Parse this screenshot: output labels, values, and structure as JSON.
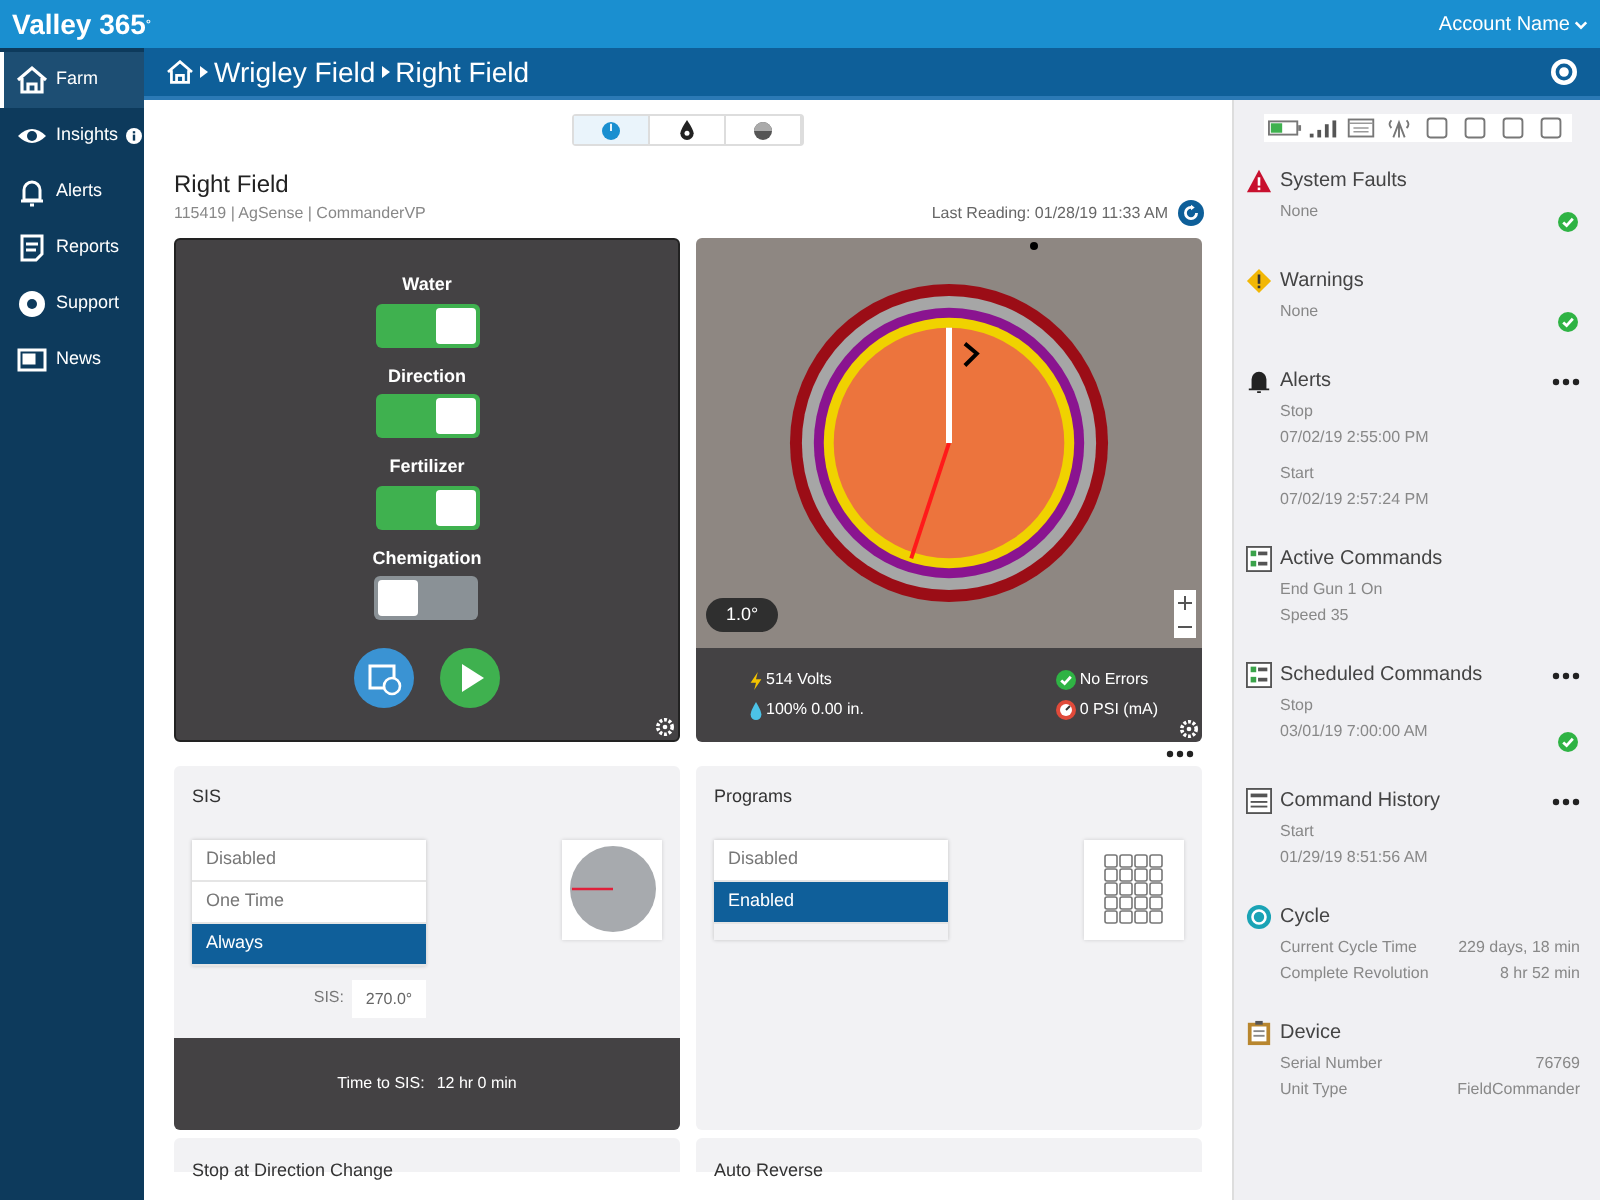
{
  "header": {
    "brand": "Valley 365",
    "brand_mark": "°",
    "account": "Account Name"
  },
  "sidebar": {
    "items": [
      {
        "label": "Farm",
        "kind": "farm",
        "selected": true,
        "badge": false
      },
      {
        "label": "Insights",
        "kind": "insights",
        "selected": false,
        "badge": true
      },
      {
        "label": "Alerts",
        "kind": "alerts",
        "selected": false,
        "badge": false
      },
      {
        "label": "Reports",
        "kind": "reports",
        "selected": false,
        "badge": false
      },
      {
        "label": "Support",
        "kind": "support",
        "selected": false,
        "badge": false
      },
      {
        "label": "News",
        "kind": "news",
        "selected": false,
        "badge": false
      }
    ]
  },
  "breadcrumb": [
    "Wrigley Field",
    "Right Field"
  ],
  "view_tabs": [
    {
      "kind": "pivot",
      "selected": true
    },
    {
      "kind": "drop",
      "selected": false
    },
    {
      "kind": "globe",
      "selected": false
    }
  ],
  "field": {
    "title": "Right Field",
    "subtitle": "115419 | AgSense | CommanderVP",
    "last_reading": "Last Reading: 01/28/19 11:33 AM"
  },
  "toggles": [
    {
      "label": "Water",
      "on": true
    },
    {
      "label": "Direction",
      "on": true
    },
    {
      "label": "Fertilizer",
      "on": true
    },
    {
      "label": "Chemigation",
      "on": false
    }
  ],
  "map": {
    "angle": "1.0°",
    "stats": [
      {
        "kind": "volts",
        "text": "514 Volts"
      },
      {
        "kind": "ok",
        "text": "No Errors"
      },
      {
        "kind": "water",
        "text": "100% 0.00 in."
      },
      {
        "kind": "pressure",
        "text": "0 PSI (mA)"
      }
    ]
  },
  "sis": {
    "title": "SIS",
    "options": [
      {
        "label": "Disabled",
        "selected": false
      },
      {
        "label": "One Time",
        "selected": false
      },
      {
        "label": "Always",
        "selected": true
      }
    ],
    "field_label": "SIS:",
    "field_value": "270.0°",
    "time_label": "Time to SIS:",
    "time_value": "12 hr 0 min"
  },
  "programs": {
    "title": "Programs",
    "options": [
      {
        "label": "Disabled",
        "selected": false
      },
      {
        "label": "Enabled",
        "selected": true
      }
    ]
  },
  "lower_panels": [
    "Stop at Direction Change",
    "Auto Reverse"
  ],
  "status_sections": [
    {
      "kind": "fault",
      "title": "System Faults",
      "groups": [
        [
          "None"
        ]
      ],
      "ok": true,
      "menu": false
    },
    {
      "kind": "warning",
      "title": "Warnings",
      "groups": [
        [
          "None"
        ]
      ],
      "ok": true,
      "menu": false
    },
    {
      "kind": "alert",
      "title": "Alerts",
      "groups": [
        [
          "Stop",
          "07/02/19 2:55:00 PM"
        ],
        [
          "Start",
          "07/02/19 2:57:24 PM"
        ]
      ],
      "ok": false,
      "menu": true
    },
    {
      "kind": "commands",
      "title": "Active Commands",
      "groups": [
        [
          "End Gun 1 On",
          "Speed 35"
        ]
      ],
      "ok": false,
      "menu": false
    },
    {
      "kind": "commands",
      "title": "Scheduled Commands",
      "groups": [
        [
          "Stop",
          "03/01/19 7:00:00 AM"
        ]
      ],
      "ok": true,
      "menu": true
    },
    {
      "kind": "history",
      "title": "Command History",
      "groups": [
        [
          "Start",
          "01/29/19 8:51:56 AM"
        ]
      ],
      "ok": false,
      "menu": true
    },
    {
      "kind": "cycle",
      "title": "Cycle",
      "rows": [
        [
          "Current Cycle Time",
          "229 days, 18 min"
        ],
        [
          "Complete Revolution",
          "8 hr 52 min"
        ]
      ],
      "ok": false,
      "menu": false
    },
    {
      "kind": "device",
      "title": "Device",
      "rows": [
        [
          "Serial Number",
          "76769"
        ],
        [
          "Unit Type",
          "FieldCommander"
        ]
      ],
      "ok": false,
      "menu": false
    }
  ]
}
